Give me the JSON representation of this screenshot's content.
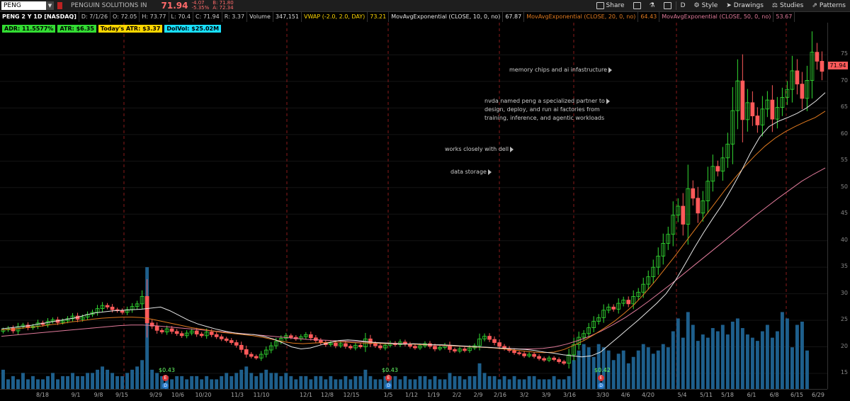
{
  "header": {
    "symbol": "PENG",
    "company": "PENGUIN SOLUTIONS IN",
    "last": "71.94",
    "change": "-4.07",
    "change_pct": "-5.35%",
    "bid": "B: 71.80",
    "ask": "A: 72.34"
  },
  "toolbar": {
    "share": "Share",
    "period": "D",
    "style": "Style",
    "drawings": "Drawings",
    "studies": "Studies",
    "patterns": "Patterns"
  },
  "studies": {
    "title": "PENG 2 Y 1D [NASDAQ]",
    "date": "D: 7/1/26",
    "open": "O: 72.05",
    "high": "H: 73.77",
    "low": "L: 70.4",
    "close": "C: 71.94",
    "range": "R: 3.37",
    "volume_label": "Volume",
    "volume": "347,151",
    "vwap_label": "VWAP (-2.0, 2.0, DAY)",
    "vwap": "73.21",
    "ema10_label": "MovAvgExponential (CLOSE, 10, 0, no)",
    "ema10": "67.87",
    "ema20_label": "MovAvgExponential (CLOSE, 20, 0, no)",
    "ema20": "64.43",
    "ema50_label": "MovAvgExponential (CLOSE, 50, 0, no)",
    "ema50": "53.67"
  },
  "labels": {
    "adr": "ADR: 11.5577%",
    "atr": "ATR: $6.35",
    "today_atr": "Today's ATR: $3.37",
    "dolvol": "DolVol: $25.02M"
  },
  "notes": {
    "memory": "memory chips and ai infastructure",
    "nvda_1": "nvda named peng a specialized partner to",
    "nvda_2": "design, deploy, and run ai factories from",
    "nvda_3": "training, inference, and agentic workloads",
    "dell": "works closely with dell",
    "storage": "data storage"
  },
  "earnings": [
    "$0.43",
    "$0.43",
    "$0.42"
  ],
  "price_tag": "71.94",
  "axis": {
    "y": [
      "75",
      "70",
      "65",
      "60",
      "55",
      "50",
      "45",
      "40",
      "35",
      "30",
      "25",
      "20",
      "15"
    ],
    "x": [
      "8/18",
      "9/1",
      "9/8",
      "9/15",
      "9/29",
      "10/6",
      "10/20",
      "11/3",
      "11/10",
      "12/1",
      "12/8",
      "12/15",
      "1/5",
      "1/12",
      "1/19",
      "2/2",
      "2/9",
      "2/16",
      "3/2",
      "3/9",
      "3/16",
      "3/30",
      "4/6",
      "4/20",
      "5/4",
      "5/11",
      "5/18",
      "6/1",
      "6/8",
      "6/15",
      "6/29"
    ]
  },
  "colors": {
    "up": "#33dd33",
    "down": "#ff5a5a",
    "volume": "#1e5f8c",
    "ema10": "#e6e6e6",
    "ema20": "#e07a1f",
    "ema50": "#e07a9a",
    "vwap": "#ffd700"
  },
  "chart_data": {
    "type": "candlestick",
    "ylim": [
      13,
      80
    ],
    "closes": [
      23.2,
      23.5,
      23.0,
      23.8,
      24.1,
      23.6,
      23.9,
      24.5,
      24.2,
      24.8,
      25.1,
      24.6,
      24.9,
      25.3,
      25.8,
      25.2,
      25.6,
      26.1,
      26.5,
      27.2,
      27.8,
      27.5,
      27.0,
      26.8,
      26.5,
      27.0,
      27.6,
      28.1,
      29.5,
      24.5,
      23.9,
      23.1,
      22.8,
      23.4,
      22.9,
      22.5,
      22.1,
      22.6,
      23.0,
      22.4,
      22.1,
      22.8,
      22.3,
      21.9,
      21.5,
      21.2,
      20.8,
      20.3,
      19.5,
      18.6,
      18.2,
      17.9,
      18.6,
      19.4,
      20.2,
      21.0,
      21.6,
      22.1,
      21.8,
      21.5,
      21.9,
      22.3,
      21.7,
      21.2,
      20.8,
      20.4,
      20.7,
      20.2,
      20.6,
      20.1,
      19.8,
      20.3,
      20.0,
      21.5,
      20.6,
      20.2,
      19.8,
      20.3,
      20.7,
      20.4,
      20.9,
      20.5,
      20.1,
      19.8,
      20.2,
      20.6,
      20.1,
      19.6,
      19.9,
      20.3,
      19.5,
      19.2,
      19.6,
      19.3,
      19.8,
      20.2,
      21.5,
      22.0,
      21.4,
      20.8,
      20.1,
      19.7,
      19.3,
      18.9,
      18.7,
      18.3,
      18.6,
      18.2,
      17.8,
      17.5,
      17.9,
      17.6,
      17.2,
      16.9,
      18.5,
      20.4,
      21.8,
      22.5,
      23.6,
      24.8,
      25.5,
      26.9,
      27.5,
      27.1,
      28.2,
      28.8,
      28.1,
      29.5,
      30.3,
      31.8,
      33.2,
      35.0,
      37.1,
      39.5,
      41.2,
      44.8,
      46.5,
      43.1,
      49.8,
      48.0,
      45.2,
      47.5,
      51.2,
      54.0,
      53.1,
      55.6,
      58.2,
      64.5,
      70.1,
      62.8,
      66.0,
      63.5,
      61.8,
      64.8,
      66.5,
      62.9,
      65.1,
      67.0,
      68.5,
      72.0,
      69.5,
      66.8,
      70.2,
      75.5,
      73.8,
      71.9
    ],
    "volumes": [
      6,
      3,
      4,
      3,
      5,
      3,
      4,
      3,
      3,
      4,
      5,
      3,
      4,
      4,
      5,
      4,
      4,
      5,
      5,
      6,
      7,
      6,
      5,
      4,
      4,
      5,
      6,
      7,
      9,
      38,
      6,
      5,
      4,
      4,
      3,
      4,
      4,
      3,
      4,
      4,
      3,
      4,
      3,
      3,
      4,
      5,
      4,
      5,
      6,
      7,
      5,
      4,
      5,
      6,
      5,
      5,
      4,
      5,
      4,
      3,
      4,
      4,
      3,
      4,
      4,
      3,
      4,
      3,
      3,
      4,
      3,
      4,
      4,
      6,
      4,
      3,
      3,
      4,
      4,
      4,
      3,
      4,
      3,
      3,
      4,
      4,
      3,
      4,
      3,
      3,
      5,
      4,
      4,
      3,
      4,
      4,
      8,
      5,
      4,
      4,
      3,
      4,
      3,
      4,
      3,
      3,
      4,
      4,
      3,
      3,
      3,
      4,
      3,
      3,
      4,
      9,
      12,
      14,
      13,
      10,
      14,
      13,
      12,
      9,
      11,
      12,
      8,
      10,
      12,
      14,
      13,
      11,
      12,
      14,
      13,
      18,
      22,
      16,
      24,
      20,
      15,
      17,
      16,
      19,
      18,
      20,
      17,
      21,
      22,
      19,
      17,
      16,
      15,
      18,
      20,
      16,
      18,
      24,
      22,
      13,
      20,
      21,
      12
    ],
    "ema10": [
      23.4,
      23.6,
      23.8,
      24.0,
      24.3,
      24.6,
      24.9,
      25.2,
      25.5,
      26.0,
      26.4,
      26.6,
      26.8,
      26.9,
      27.0,
      27.1,
      27.3,
      27.5,
      26.8,
      25.9,
      25.0,
      24.3,
      23.8,
      23.3,
      22.9,
      22.6,
      22.4,
      22.3,
      22.0,
      21.5,
      20.8,
      20.0,
      19.6,
      19.8,
      20.3,
      20.8,
      21.2,
      21.3,
      21.2,
      21.0,
      20.8,
      20.7,
      20.6,
      20.5,
      20.6,
      20.5,
      20.4,
      20.4,
      20.3,
      20.2,
      20.1,
      20.0,
      19.9,
      19.8,
      19.7,
      19.6,
      19.5,
      19.3,
      19.0,
      18.8,
      18.5,
      18.3,
      18.1,
      18.3,
      19.0,
      20.5,
      22.0,
      23.5,
      25.0,
      26.6,
      28.2,
      30.0,
      32.5,
      35.5,
      38.6,
      41.5,
      44.2,
      46.8,
      49.8,
      53.0,
      56.5,
      59.5,
      61.5,
      62.5,
      63.2,
      64.0,
      65.0,
      66.3,
      67.9
    ],
    "ema20": [
      23.2,
      23.3,
      23.5,
      23.7,
      23.9,
      24.2,
      24.4,
      24.7,
      24.9,
      25.2,
      25.4,
      25.5,
      25.6,
      25.6,
      25.5,
      25.2,
      24.8,
      24.4,
      24.0,
      23.6,
      23.3,
      23.0,
      22.7,
      22.5,
      22.3,
      22.1,
      21.8,
      21.4,
      21.0,
      20.7,
      20.6,
      20.7,
      20.8,
      20.9,
      20.9,
      20.8,
      20.7,
      20.7,
      20.6,
      20.6,
      20.5,
      20.5,
      20.4,
      20.4,
      20.3,
      20.2,
      20.1,
      20.0,
      19.9,
      19.8,
      19.6,
      19.4,
      19.2,
      19.0,
      18.9,
      19.0,
      19.5,
      20.3,
      21.2,
      22.3,
      23.5,
      24.8,
      26.3,
      28.0,
      30.0,
      32.2,
      34.6,
      37.0,
      39.5,
      42.0,
      44.5,
      47.0,
      49.5,
      51.8,
      54.0,
      56.0,
      57.8,
      59.3,
      60.5,
      61.5,
      62.4,
      63.2,
      64.4
    ],
    "ema50": [
      22.0,
      22.2,
      22.4,
      22.6,
      22.8,
      23.0,
      23.2,
      23.4,
      23.6,
      23.8,
      24.0,
      24.1,
      24.1,
      24.0,
      23.8,
      23.6,
      23.4,
      23.2,
      23.0,
      22.8,
      22.6,
      22.4,
      22.2,
      22.0,
      21.8,
      21.6,
      21.4,
      21.3,
      21.2,
      21.1,
      21.0,
      20.9,
      20.8,
      20.7,
      20.6,
      20.5,
      20.4,
      20.3,
      20.2,
      20.1,
      20.0,
      19.9,
      19.8,
      19.7,
      19.6,
      19.6,
      19.7,
      20.0,
      20.5,
      21.2,
      22.0,
      23.0,
      24.2,
      25.5,
      27.0,
      28.6,
      30.3,
      32.0,
      33.8,
      35.6,
      37.4,
      39.2,
      41.0,
      42.8,
      44.6,
      46.3,
      48.0,
      49.6,
      51.2,
      52.5,
      53.7
    ]
  }
}
